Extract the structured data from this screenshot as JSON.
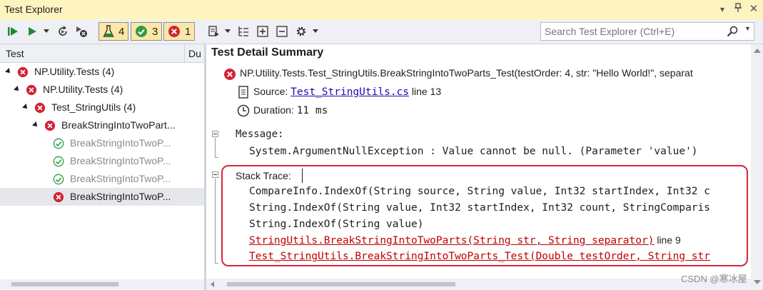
{
  "window": {
    "title": "Test Explorer"
  },
  "toolbar": {
    "counters": {
      "total": "4",
      "passed": "3",
      "failed": "1"
    }
  },
  "search": {
    "placeholder": "Search Test Explorer (Ctrl+E)"
  },
  "tree": {
    "column_test": "Test",
    "column_duration": "Du",
    "rows": [
      {
        "label": "NP.Utility.Tests  (4)",
        "status": "failed"
      },
      {
        "label": "NP.Utility.Tests  (4)",
        "status": "failed"
      },
      {
        "label": "Test_StringUtils  (4)",
        "status": "failed"
      },
      {
        "label": "BreakStringIntoTwoPart...",
        "status": "failed"
      },
      {
        "label": "BreakStringIntoTwoP...",
        "status": "passed"
      },
      {
        "label": "BreakStringIntoTwoP...",
        "status": "passed"
      },
      {
        "label": "BreakStringIntoTwoP...",
        "status": "passed"
      },
      {
        "label": "BreakStringIntoTwoP...",
        "status": "failed",
        "selected": true
      }
    ]
  },
  "detail": {
    "heading": "Test Detail Summary",
    "test_name": "NP.Utility.Tests.Test_StringUtils.BreakStringIntoTwoParts_Test(testOrder: 4, str: \"Hello World!\", separat",
    "source_label": "Source:",
    "source_file": "Test_StringUtils.cs",
    "source_line": "line 13",
    "duration_label": "Duration:",
    "duration_value": "11 ms",
    "message_label": "Message:",
    "message_text": "System.ArgumentNullException : Value cannot be null. (Parameter 'value')",
    "stack_label": "Stack Trace:",
    "stack": [
      "CompareInfo.IndexOf(String source, String value, Int32 startIndex, Int32 c",
      "String.IndexOf(String value, Int32 startIndex, Int32 count, StringComparis",
      "String.IndexOf(String value)"
    ],
    "stack_link_1": "StringUtils.BreakStringIntoTwoParts(String str, String separator)",
    "stack_link_1_line": "line 9",
    "stack_link_2": "Test_StringUtils.BreakStringIntoTwoParts_Test(Double testOrder, String str"
  },
  "watermark": "CSDN @寒冰屋",
  "colors": {
    "titlebar": "#fdf4bf",
    "failed": "#d32236",
    "passed": "#2e9d47",
    "counter_bg": "#fbe8a6",
    "highlight": "#d4283a"
  },
  "icons": [
    "run-all-icon",
    "run-icon",
    "dropdown-icon",
    "refresh-icon",
    "cancel-run-icon",
    "flask-icon",
    "pass-icon",
    "fail-icon",
    "playlist-icon",
    "hierarchy-icon",
    "expand-all-icon",
    "collapse-all-icon",
    "settings-icon",
    "search-icon"
  ]
}
